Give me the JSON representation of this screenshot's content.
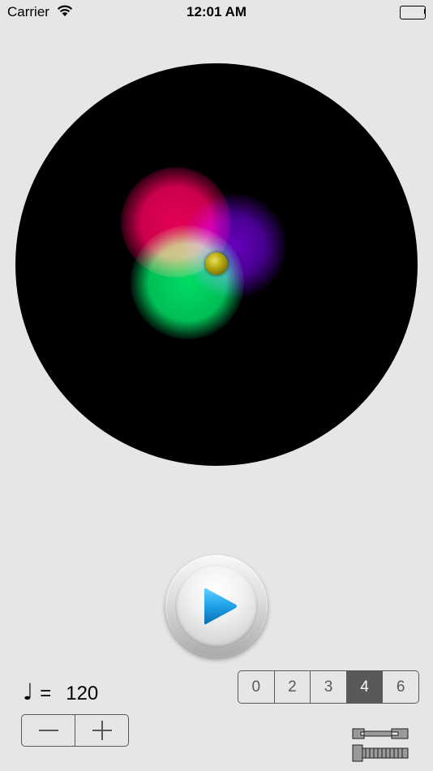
{
  "status_bar": {
    "carrier": "Carrier",
    "time": "12:01 AM",
    "icons": [
      "wifi-icon",
      "battery-icon"
    ]
  },
  "visualizer": {
    "background": "#000000",
    "orbs": [
      "red",
      "purple",
      "green"
    ],
    "ball_color": "#b5a80c"
  },
  "play_button": {
    "icon": "play-icon",
    "accent": "#1ea0e8"
  },
  "tempo": {
    "note_symbol": "♩",
    "equals": "=",
    "value": "120"
  },
  "tempo_stepper": {
    "minus_icon": "minus-icon",
    "plus_icon": "plus-icon"
  },
  "beats_selector": {
    "options": [
      "0",
      "2",
      "3",
      "4",
      "6"
    ],
    "selected": "4"
  },
  "settings_button": {
    "icon": "wrench-screw-icon"
  }
}
